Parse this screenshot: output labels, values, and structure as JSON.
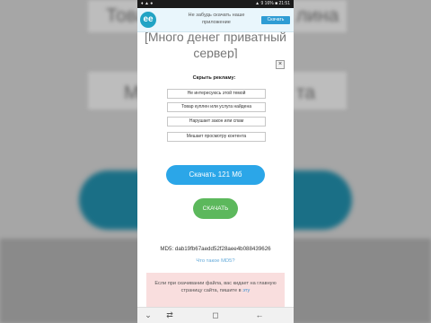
{
  "background_page": {
    "ghost_left_1": "Това",
    "ghost_right_1": "лина",
    "ghost_left_2": "Ме",
    "ghost_right_2": "та"
  },
  "status_bar": {
    "left_icons": "♦ ▲ ●",
    "right": "▲ 9 16% ■ 21:51"
  },
  "app_banner": {
    "logo_text": "ee",
    "message": "Не забудь скачать наше приложение",
    "button_label": "Скачать"
  },
  "page": {
    "title": "[Много денег приватный сервер]"
  },
  "ad_panel": {
    "close_symbol": "×",
    "heading": "Скрыть рекламу:",
    "options": [
      "Не интересуюсь этой темой",
      "Товар куплен или услуга найдена",
      "Нарушает закон или спам",
      "Мешает просмотру контента"
    ]
  },
  "download": {
    "primary_label": "Скачать 121 Мб",
    "secondary_label": "СКАЧАТЬ"
  },
  "md5": {
    "line": "MD5: dab19fb67aedd52f28aee4b088439626",
    "help_link": "Что такое MD5?"
  },
  "notice": {
    "text": "Если при скачивании файла, вас кидает на главную страницу сайта, пишите в",
    "link": "эту"
  },
  "nav_bar": {
    "down": "⌄",
    "recent": "⇄",
    "home": "◻",
    "back": "←"
  },
  "colors": {
    "accent_blue": "#2ba6e8",
    "accent_green": "#5cb85c",
    "banner_bg": "#e9f6fc",
    "notice_bg": "#f9dede"
  }
}
